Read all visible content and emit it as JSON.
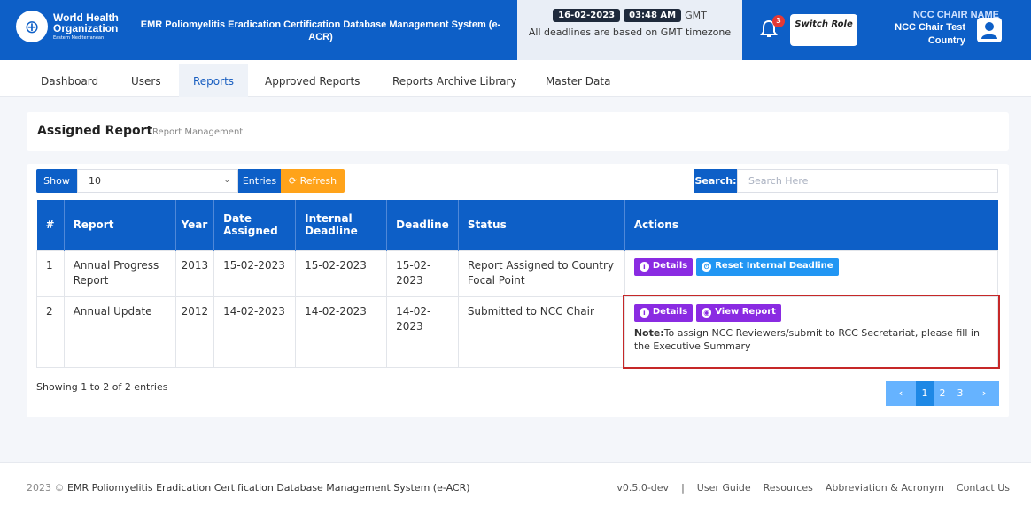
{
  "header": {
    "logo": {
      "org_line1": "World Health",
      "org_line2": "Organization",
      "region": "Eastern Mediterranean"
    },
    "system_title": "EMR Poliomyelitis Eradication Certification Database Management System (e-ACR)",
    "date": "16-02-2023",
    "time": "03:48 AM",
    "timezone": "GMT",
    "deadline_note": "All deadlines are based on GMT timezone",
    "notification_count": "3",
    "switch_role": "Switch Role",
    "user_caption": "NCC CHAIR NAME",
    "user_name": "NCC Chair Test",
    "user_country": "Country"
  },
  "nav": {
    "items": [
      "Dashboard",
      "Users",
      "Reports",
      "Approved Reports",
      "Reports Archive Library",
      "Master Data"
    ],
    "active": "Reports"
  },
  "page": {
    "title": "Assigned Report",
    "subtitle": "Report Management"
  },
  "controls": {
    "show_label": "Show",
    "show_value": "10",
    "entries_label": "Entries",
    "refresh_label": "Refresh",
    "search_label": "Search:",
    "search_placeholder": "Search Here"
  },
  "table": {
    "headers": [
      "#",
      "Report",
      "Year",
      "Date Assigned",
      "Internal Deadline",
      "Deadline",
      "Status",
      "Actions"
    ],
    "rows": [
      {
        "num": "1",
        "report": "Annual Progress Report",
        "year": "2013",
        "date_assigned": "15-02-2023",
        "internal_deadline": "15-02-2023",
        "deadline": "15-02-2023",
        "status": "Report Assigned to Country Focal Point",
        "actions": [
          "Details",
          "Reset Internal Deadline"
        ]
      },
      {
        "num": "2",
        "report": "Annual Update",
        "year": "2012",
        "date_assigned": "14-02-2023",
        "internal_deadline": "14-02-2023",
        "deadline": "14-02-2023",
        "status": "Submitted to NCC Chair",
        "actions": [
          "Details",
          "View Report"
        ],
        "note_label": "Note:",
        "note_text": "To assign NCC Reviewers/submit to RCC Secretariat, please fill in the Executive Summary"
      }
    ]
  },
  "pagination": {
    "summary": "Showing 1 to 2 of 2 entries",
    "pages": [
      "1",
      "2",
      "3"
    ],
    "active_page": "1"
  },
  "footer": {
    "year": "2023 ©",
    "system": "EMR Poliomyelitis Eradication Certification Database Management System (e-ACR)",
    "version": "v0.5.0-dev",
    "links": [
      "User Guide",
      "Resources",
      "Abbreviation & Acronym",
      "Contact Us"
    ]
  },
  "colors": {
    "primary": "#0d5fc7",
    "refresh": "#ffa31a",
    "details": "#8a2be2",
    "reset": "#2196f3",
    "highlight": "#c62828"
  }
}
